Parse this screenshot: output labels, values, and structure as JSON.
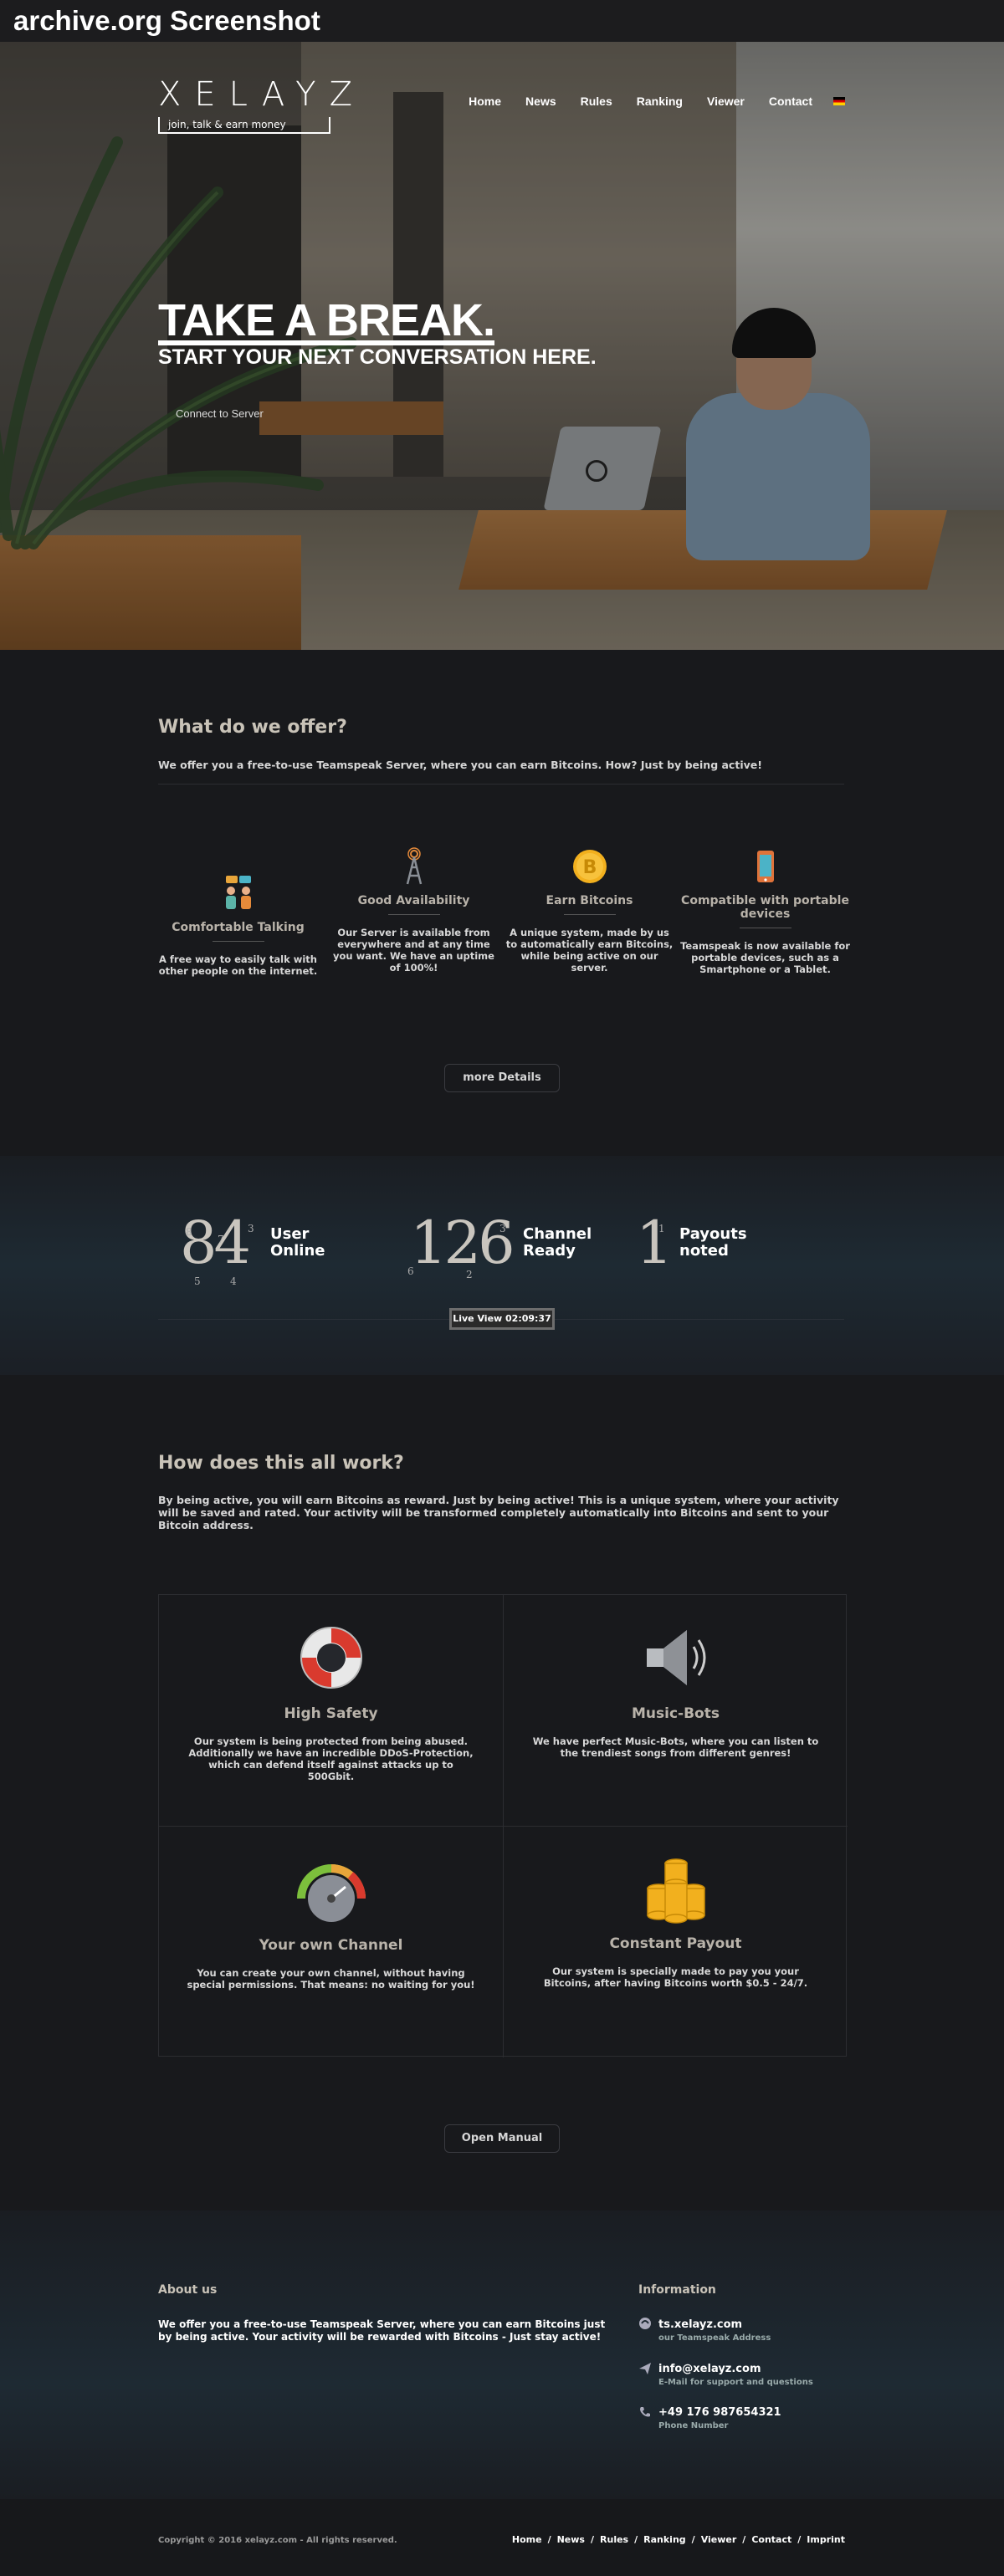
{
  "archive_bar": {
    "title": "archive.org Screenshot"
  },
  "header": {
    "logo": "XELAYZ",
    "logo_sub": "join, talk & earn money",
    "nav": [
      "Home",
      "News",
      "Rules",
      "Ranking",
      "Viewer",
      "Contact"
    ]
  },
  "hero": {
    "title": "TAKE A BREAK.",
    "subtitle": "START YOUR NEXT CONVERSATION HERE.",
    "button": "Connect to Server"
  },
  "offer": {
    "title": "What do we offer?",
    "text": "We offer you a free-to-use Teamspeak Server, where you can earn Bitcoins. How? Just by being active!",
    "features": [
      {
        "title": "Comfortable Talking",
        "desc": "A free way to easily talk with other people on the internet.",
        "icon": "chat-people-icon"
      },
      {
        "title": "Good Availability",
        "desc": "Our Server is available from everywhere and at any time you want. We have an uptime of 100%!",
        "icon": "antenna-icon"
      },
      {
        "title": "Earn Bitcoins",
        "desc": "A unique system, made by us to automatically earn Bitcoins, while being active on our server.",
        "icon": "bitcoin-icon"
      },
      {
        "title": "Compatible with portable devices",
        "desc": "Teamspeak is now available for portable devices, such as a Smartphone or a Tablet.",
        "icon": "smartphone-icon"
      }
    ],
    "button": "more Details"
  },
  "stats": {
    "users": {
      "value": "84",
      "label1": "User",
      "label2": "Online"
    },
    "channels": {
      "value": "126",
      "label1": "Channel",
      "label2": "Ready"
    },
    "payouts": {
      "value": "1",
      "label1": "Payouts",
      "label2": "noted"
    },
    "live": "Live View 02:09:37"
  },
  "how": {
    "title": "How does this all work?",
    "text": "By being active, you will earn Bitcoins as reward. Just by being active! This is a unique system, where your activity will be saved and rated. Your activity will be transformed completely automatically into Bitcoins and sent to your Bitcoin address.",
    "cells": [
      {
        "title": "High Safety",
        "desc": "Our system is being protected from being abused. Additionally we have an incredible DDoS-Protection, which can defend itself against attacks up to 500Gbit.",
        "icon": "lifebuoy-icon"
      },
      {
        "title": "Music-Bots",
        "desc": "We have perfect Music-Bots, where you can listen to the trendiest songs from different genres!",
        "icon": "speaker-icon"
      },
      {
        "title": "Your own Channel",
        "desc": "You can create your own channel, without having special permissions. That means: no waiting for you!",
        "icon": "gauge-icon"
      },
      {
        "title": "Constant Payout",
        "desc": "Our system is specially made to pay you your Bitcoins, after having Bitcoins worth $0.5 - 24/7.",
        "icon": "coins-icon"
      }
    ],
    "button": "Open Manual"
  },
  "footer": {
    "about_title": "About us",
    "about_text": "We offer you a free-to-use Teamspeak Server, where you can earn Bitcoins just by being active. Your activity will be rewarded with Bitcoins - Just stay active!",
    "info_title": "Information",
    "info": [
      {
        "main": "ts.xelayz.com",
        "sub": "our Teamspeak Address",
        "icon": "teamspeak-icon"
      },
      {
        "main": "info@xelayz.com",
        "sub": "E-Mail for support and questions",
        "icon": "paper-plane-icon"
      },
      {
        "main": "+49 176 987654321",
        "sub": "Phone Number",
        "icon": "phone-icon"
      }
    ],
    "copyright": "Copyright © 2016 xelayz.com - All rights reserved.",
    "nav": [
      "Home",
      "News",
      "Rules",
      "Ranking",
      "Viewer",
      "Contact",
      "Imprint"
    ]
  }
}
